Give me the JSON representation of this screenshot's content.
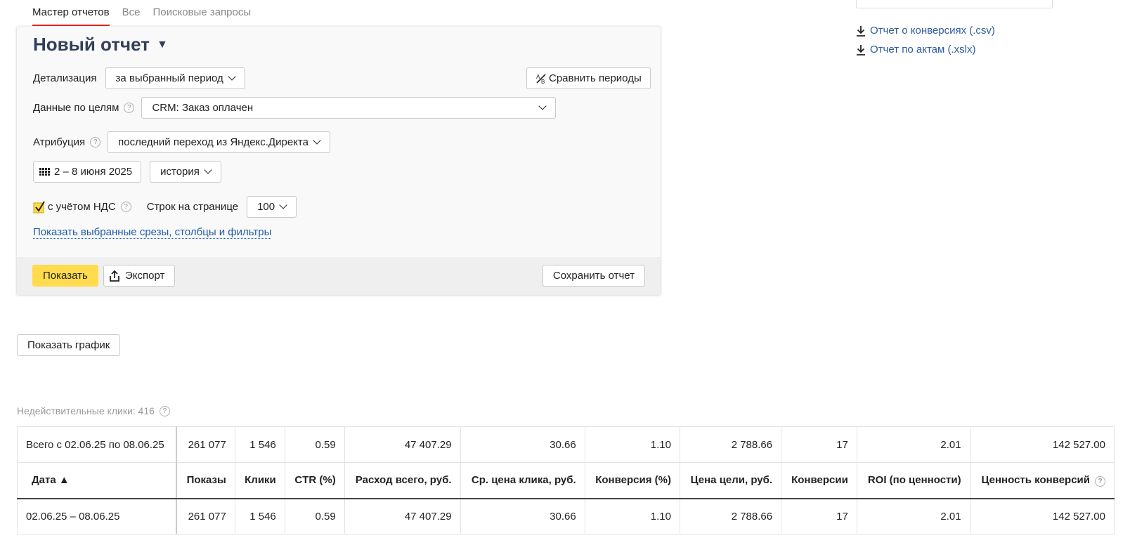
{
  "tabs": [
    "Мастер отчетов",
    "Все",
    "Поисковые запросы"
  ],
  "report": {
    "title": "Новый отчет",
    "detail_label": "Детализация",
    "detail_value": "за выбранный период",
    "compare_label": "Сравнить периоды",
    "goals_label": "Данные по целям",
    "goals_value": "CRM: Заказ оплачен",
    "attribution_label": "Атрибуция",
    "attribution_value": "последний переход из Яндекс.Директа",
    "date_range": "2 – 8 июня 2025",
    "history_value": "история",
    "vat_label": "с учётом НДС",
    "vat_checked": true,
    "rows_label": "Строк на странице",
    "rows_value": "100",
    "show_filters_link": "Показать выбранные срезы, столбцы и фильтры",
    "show_button": "Показать",
    "export_button": "Экспорт",
    "save_button": "Сохранить отчет"
  },
  "downloads": [
    "Отчет о конверсиях (.csv)",
    "Отчет по актам (.xslx)"
  ],
  "show_chart_button": "Показать график",
  "invalid_clicks": "Недействительные клики: 416",
  "table": {
    "total_row": [
      "Всего с 02.06.25 по 08.06.25",
      "261 077",
      "1 546",
      "0.59",
      "47 407.29",
      "30.66",
      "1.10",
      "2 788.66",
      "17",
      "2.01",
      "142 527.00"
    ],
    "headers": [
      "Дата ▲",
      "Показы",
      "Клики",
      "CTR (%)",
      "Расход всего, руб.",
      "Ср. цена клика, руб.",
      "Конверсия (%)",
      "Цена цели, руб.",
      "Конверсии",
      "ROI (по ценности)",
      "Ценность конверсий"
    ],
    "rows": [
      [
        "02.06.25 – 08.06.25",
        "261 077",
        "1 546",
        "0.59",
        "47 407.29",
        "30.66",
        "1.10",
        "2 788.66",
        "17",
        "2.01",
        "142 527.00"
      ]
    ]
  },
  "colors": {
    "accent_red": "#e52620",
    "button_yellow": "#ffdb4d",
    "link_blue": "#2e5aa0",
    "title_navy": "#333f58"
  },
  "icons": [
    "download-icon",
    "compare-icon",
    "calendar-icon",
    "export-icon",
    "help-icon",
    "checkbox-icon",
    "chevron-down-icon"
  ]
}
